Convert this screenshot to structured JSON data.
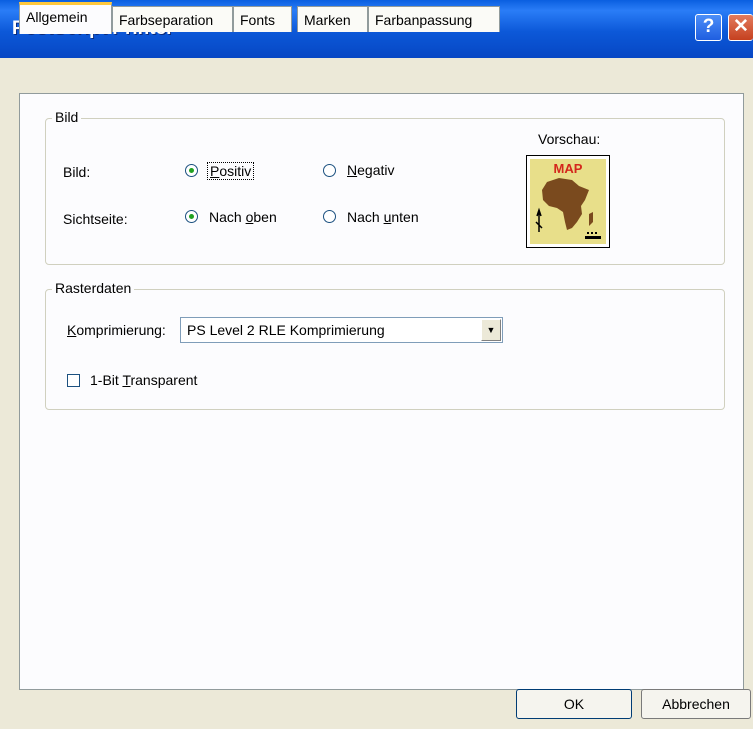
{
  "window": {
    "title": "PostScript Printer",
    "help_glyph": "?",
    "close_glyph": "✕"
  },
  "tabs": [
    {
      "label": "Allgemein",
      "active": true
    },
    {
      "label": "Farbseparation",
      "active": false
    },
    {
      "label": "Fonts",
      "active": false
    },
    {
      "label": "Marken",
      "active": false
    },
    {
      "label": "Farbanpassung",
      "active": false
    }
  ],
  "bild_group": {
    "legend": "Bild",
    "preview_label": "Vorschau:",
    "preview_map_text": "MAP",
    "bild_label": "Bild:",
    "positiv": {
      "pre": "",
      "key": "P",
      "post": "ositiv",
      "checked": true
    },
    "negativ": {
      "pre": "",
      "key": "N",
      "post": "egativ",
      "checked": false
    },
    "sichtseite_label": "Sichtseite:",
    "nach_oben": {
      "pre": "Nach ",
      "key": "o",
      "post": "ben",
      "checked": true
    },
    "nach_unten": {
      "pre": "Nach ",
      "key": "u",
      "post": "nten",
      "checked": false
    }
  },
  "raster_group": {
    "legend": "Rasterdaten",
    "komp_label": {
      "pre": "",
      "key": "K",
      "post": "omprimierung:"
    },
    "komp_value": "PS Level 2 RLE Komprimierung",
    "transparent": {
      "pre": "1-Bit ",
      "key": "T",
      "post": "ransparent",
      "checked": false
    }
  },
  "buttons": {
    "ok": "OK",
    "cancel": "Abbrechen"
  },
  "colors": {
    "title_bar": "#0a5fe0",
    "dialog_bg": "#ece9d8",
    "panel_bg": "#fcfcfe",
    "radio_dot": "#21a121",
    "tab_highlight": "#ffc83c",
    "map_land": "#7a4a1e",
    "map_bg": "#e8df8a",
    "map_text": "#d4271c"
  }
}
